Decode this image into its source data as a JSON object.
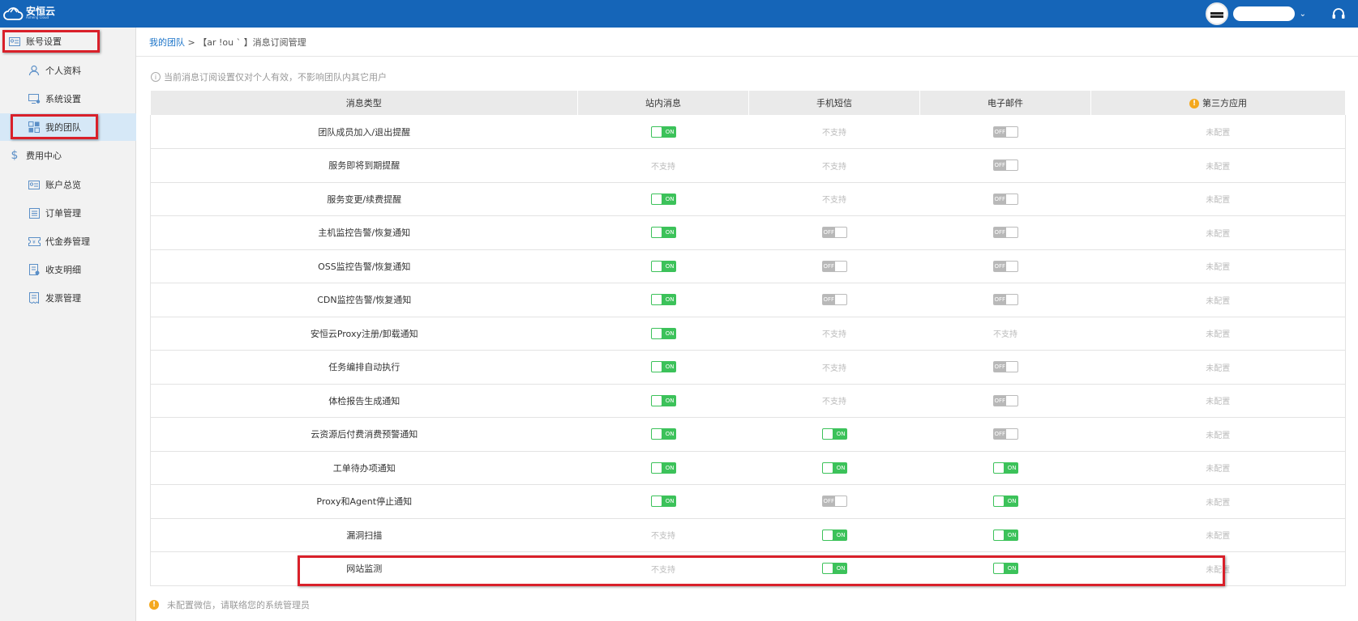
{
  "brand": {
    "name": "安恒云",
    "sub": "Anheng Cloud"
  },
  "header": {
    "dropdown_icon": "chevron-down-icon",
    "support_icon": "headset-icon"
  },
  "sidebar": {
    "groups": [
      {
        "label": "账号设置",
        "icon": "id-card-icon",
        "items": [
          {
            "label": "个人资料",
            "icon": "user-icon"
          },
          {
            "label": "系统设置",
            "icon": "monitor-gear-icon"
          },
          {
            "label": "我的团队",
            "icon": "team-grid-icon",
            "active": true
          }
        ]
      },
      {
        "label": "费用中心",
        "icon": "dollar-icon",
        "items": [
          {
            "label": "账户总览",
            "icon": "id-card-icon"
          },
          {
            "label": "订单管理",
            "icon": "list-icon"
          },
          {
            "label": "代金券管理",
            "icon": "coupon-icon"
          },
          {
            "label": "收支明细",
            "icon": "detail-icon"
          },
          {
            "label": "发票管理",
            "icon": "invoice-icon"
          }
        ]
      }
    ]
  },
  "breadcrumb": {
    "link": "我的团队",
    "separator": ">",
    "current": "【ar   !ou ` 】消息订阅管理"
  },
  "notice": "当前消息订阅设置仅对个人有效，不影响团队内其它用户",
  "table": {
    "columns": [
      "消息类型",
      "站内消息",
      "手机短信",
      "电子邮件",
      "第三方应用"
    ],
    "toggle_on_text": "ON",
    "toggle_off_text": "OFF",
    "rows": [
      {
        "type": "团队成员加入/退出提醒",
        "cells": [
          "on",
          "不支持",
          "off",
          "未配置"
        ]
      },
      {
        "type": "服务即将到期提醒",
        "cells": [
          "不支持",
          "不支持",
          "off",
          "未配置"
        ]
      },
      {
        "type": "服务变更/续费提醒",
        "cells": [
          "on",
          "不支持",
          "off",
          "未配置"
        ]
      },
      {
        "type": "主机监控告警/恢复通知",
        "cells": [
          "on",
          "off",
          "off",
          "未配置"
        ]
      },
      {
        "type": "OSS监控告警/恢复通知",
        "cells": [
          "on",
          "off",
          "off",
          "未配置"
        ]
      },
      {
        "type": "CDN监控告警/恢复通知",
        "cells": [
          "on",
          "off",
          "off",
          "未配置"
        ]
      },
      {
        "type": "安恒云Proxy注册/卸载通知",
        "cells": [
          "on",
          "不支持",
          "不支持",
          "未配置"
        ]
      },
      {
        "type": "任务编排自动执行",
        "cells": [
          "on",
          "不支持",
          "off",
          "未配置"
        ]
      },
      {
        "type": "体检报告生成通知",
        "cells": [
          "on",
          "不支持",
          "off",
          "未配置"
        ]
      },
      {
        "type": "云资源后付费消费预警通知",
        "cells": [
          "on",
          "on",
          "off",
          "未配置"
        ]
      },
      {
        "type": "工单待办项通知",
        "cells": [
          "on",
          "on",
          "on",
          "未配置"
        ]
      },
      {
        "type": "Proxy和Agent停止通知",
        "cells": [
          "on",
          "off",
          "on",
          "未配置"
        ]
      },
      {
        "type": "漏洞扫描",
        "cells": [
          "不支持",
          "on",
          "on",
          "未配置"
        ]
      },
      {
        "type": "网站监测",
        "cells": [
          "不支持",
          "on",
          "on",
          "未配置"
        ]
      }
    ]
  },
  "footer_note": "未配置微信，请联络您的系统管理员",
  "colors": {
    "topbar": "#1565b8",
    "toggle_on": "#3cc25a",
    "toggle_off": "#b8b8b8",
    "highlight": "#d9202a",
    "warning": "#f4a81d"
  }
}
